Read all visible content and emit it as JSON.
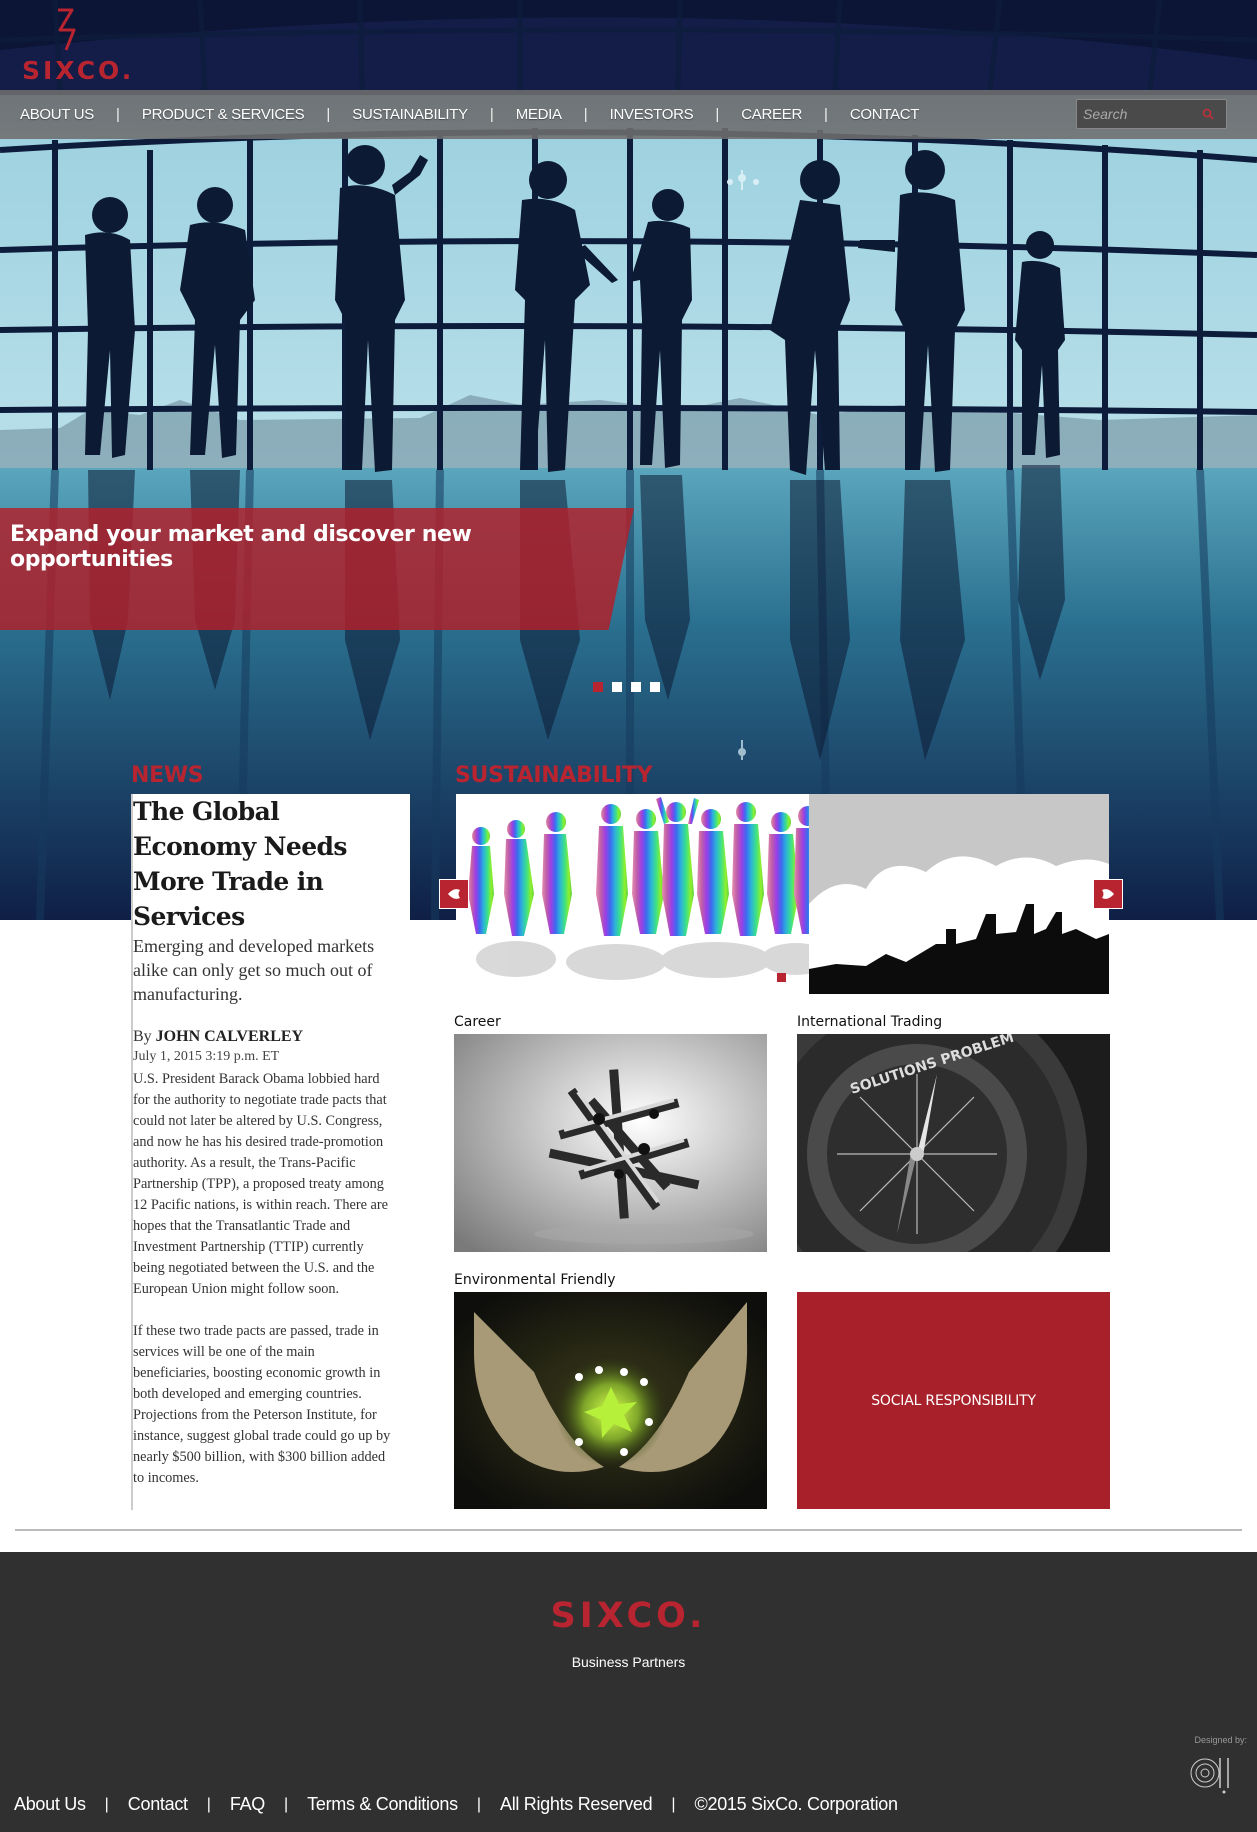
{
  "brand": {
    "name": "SIXCO.",
    "color": "#b8242f"
  },
  "nav": {
    "items": [
      {
        "label": "ABOUT US"
      },
      {
        "label": "PRODUCT & SERVICES"
      },
      {
        "label": "SUSTAINABILITY"
      },
      {
        "label": "MEDIA"
      },
      {
        "label": "INVESTORS"
      },
      {
        "label": "CAREER"
      },
      {
        "label": "CONTACT"
      }
    ],
    "separator": "|"
  },
  "search": {
    "placeholder": "Search",
    "icon": "search-icon"
  },
  "hero": {
    "tagline": "Expand your market and discover new opportunities",
    "slides_count": 4,
    "active_slide": 1
  },
  "news": {
    "section_title": "NEWS",
    "headline": "The Global Economy Needs More Trade in Services",
    "dek": "Emerging and developed markets alike can only get so much out of manufacturing.",
    "byline_prefix": "By",
    "author": "JOHN CALVERLEY",
    "date": "July 1, 2015 3:19 p.m. ET",
    "paragraphs": [
      "U.S. President Barack Obama lobbied hard for the authority to negotiate trade pacts that could not later be altered by U.S. Congress, and now he has his desired trade-promotion authority. As a result, the Trans-Pacific Partnership (TPP), a proposed treaty among 12 Pacific nations, is within reach. There are hopes that the Transatlantic Trade and Investment Partnership (TTIP) currently being negotiated between the U.S. and the European Union might follow soon.",
      "If these two trade pacts are passed, trade in services will be one of the main beneficiaries, boosting economic growth in both developed and emerging countries. Projections from the Peterson Institute, for instance, suggest global trade could go up by nearly $500 billion, with $300 billion added to incomes."
    ]
  },
  "sustainability": {
    "section_title": "SUSTAINABILITY"
  },
  "tiles": {
    "career": "Career",
    "international_trading": "International Trading",
    "environmental": "Environmental Friendly",
    "social": "SOCIAL RESPONSIBILITY"
  },
  "footer": {
    "logo": "SIXCO.",
    "tagline": "Business Partners",
    "designed_by": "Designed by:",
    "links": [
      "About Us",
      "Contact",
      "FAQ",
      "Terms & Conditions",
      "All Rights Reserved",
      "©2015 SixCo. Corporation"
    ],
    "separator": "|"
  }
}
